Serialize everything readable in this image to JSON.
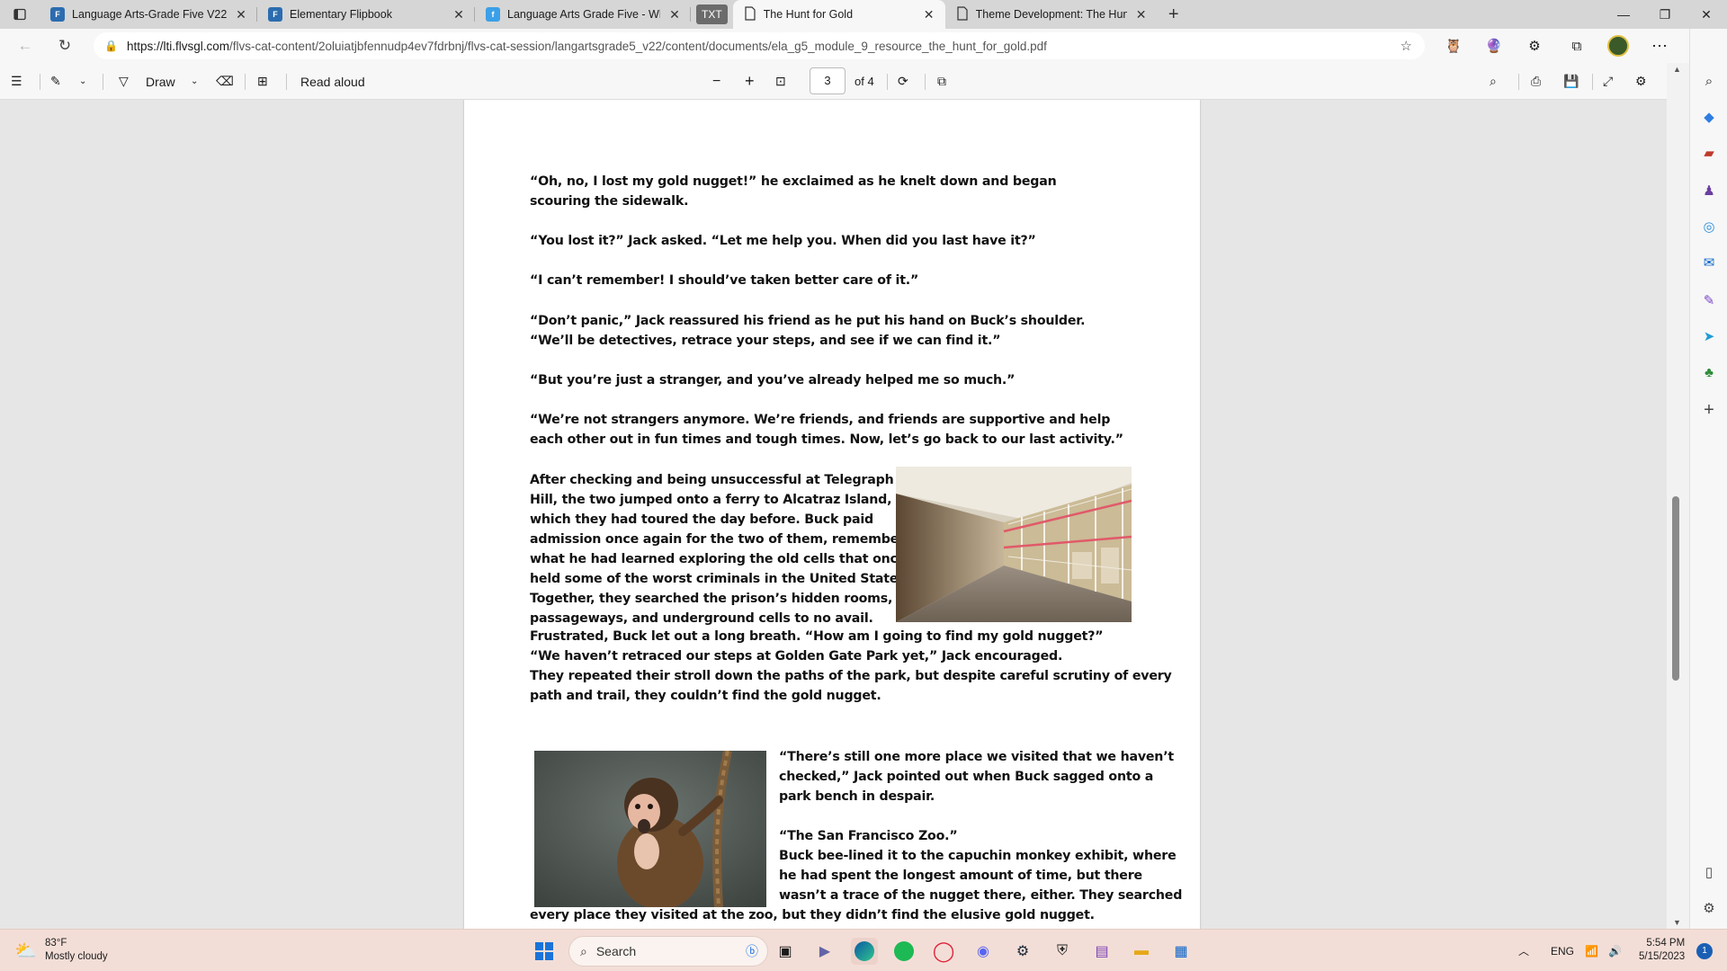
{
  "browser": {
    "tabs": [
      {
        "title": "Language Arts-Grade Five V22 (",
        "favicon": "flvs",
        "active": false
      },
      {
        "title": "Elementary Flipbook",
        "favicon": "flvs",
        "active": false
      },
      {
        "title": "Language Arts Grade Five - What",
        "favicon": "flvs-web",
        "active": false
      },
      {
        "title": "The Hunt for Gold",
        "favicon": "document",
        "active": true
      },
      {
        "title": "Theme Development: The Hunt f",
        "favicon": "document",
        "active": false
      }
    ],
    "txt_tab": "TXT",
    "url_host": "https://lti.flvsgl.com",
    "url_path": "/flvs-cat-content/2oluiatjbfennudp4ev7fdrbnj/flvs-cat-session/langartsgrade5_v22/content/documents/ela_g5_module_9_resource_the_hunt_for_gold.pdf"
  },
  "pdf_toolbar": {
    "draw_label": "Draw",
    "read_aloud_label": "Read aloud",
    "page_current": "3",
    "page_total": "of 4"
  },
  "document": {
    "paragraphs": [
      "“Oh, no, I lost my gold nugget!” he exclaimed as he knelt down and began scouring the sidewalk.",
      "“You lost it?” Jack asked. “Let me help you. When did you last have it?”",
      "“I can’t remember! I should’ve taken better care of it.”",
      "“Don’t panic,” Jack reassured his friend as he put his hand on Buck’s shoulder. “We’ll be detectives, retrace your steps, and see if we can find it.”",
      "“But you’re just a stranger, and you’ve already helped me so much.”",
      "“We’re not strangers anymore. We’re friends, and friends are supportive and help each other out in fun times and tough times. Now, let’s go back to our last activity.”"
    ],
    "alcatraz_lines": [
      "After checking and being unsuccessful at Telegraph",
      "Hill, the two jumped onto a ferry to Alcatraz Island,",
      "which they had toured the day before. Buck paid",
      "admission once again for the two of them, remembering",
      "what he had learned exploring the old cells that once",
      "held some of the worst criminals in the United States.",
      "Together, they searched the prison’s hidden rooms,",
      "passageways, and underground cells to no avail."
    ],
    "park_lines": [
      "Frustrated, Buck let out a long breath. “How am I going to find my gold nugget?”",
      "“We haven’t retraced our steps at Golden Gate Park yet,” Jack encouraged.",
      "They repeated their stroll down the paths of the park, but despite careful scrutiny of every",
      "path and trail, they couldn’t find the gold nugget."
    ],
    "zoo_lines_a": [
      "“There’s still one more place we visited that we haven’t",
      "checked,” Jack pointed out when Buck sagged onto a",
      "park bench in despair."
    ],
    "zoo_lines_b": [
      "“The San Francisco Zoo.”",
      "Buck bee-lined it to the capuchin monkey exhibit, where",
      "he had spent the longest amount of time, but there",
      "wasn’t a trace of the nugget there, either. They searched"
    ],
    "zoo_last_line": "every place they visited at the zoo, but they didn’t find the elusive gold nugget."
  },
  "taskbar": {
    "weather_temp": "83°F",
    "weather_desc": "Mostly cloudy",
    "search_placeholder": "Search",
    "language": "ENG",
    "time": "5:54 PM",
    "date": "5/15/2023",
    "notification_count": "1"
  },
  "colors": {
    "taskbar_bg": "#f3ded7",
    "tab_strip_bg": "#d6d6d6",
    "page_bg": "#ffffff",
    "accent": "#0f6cbd"
  }
}
